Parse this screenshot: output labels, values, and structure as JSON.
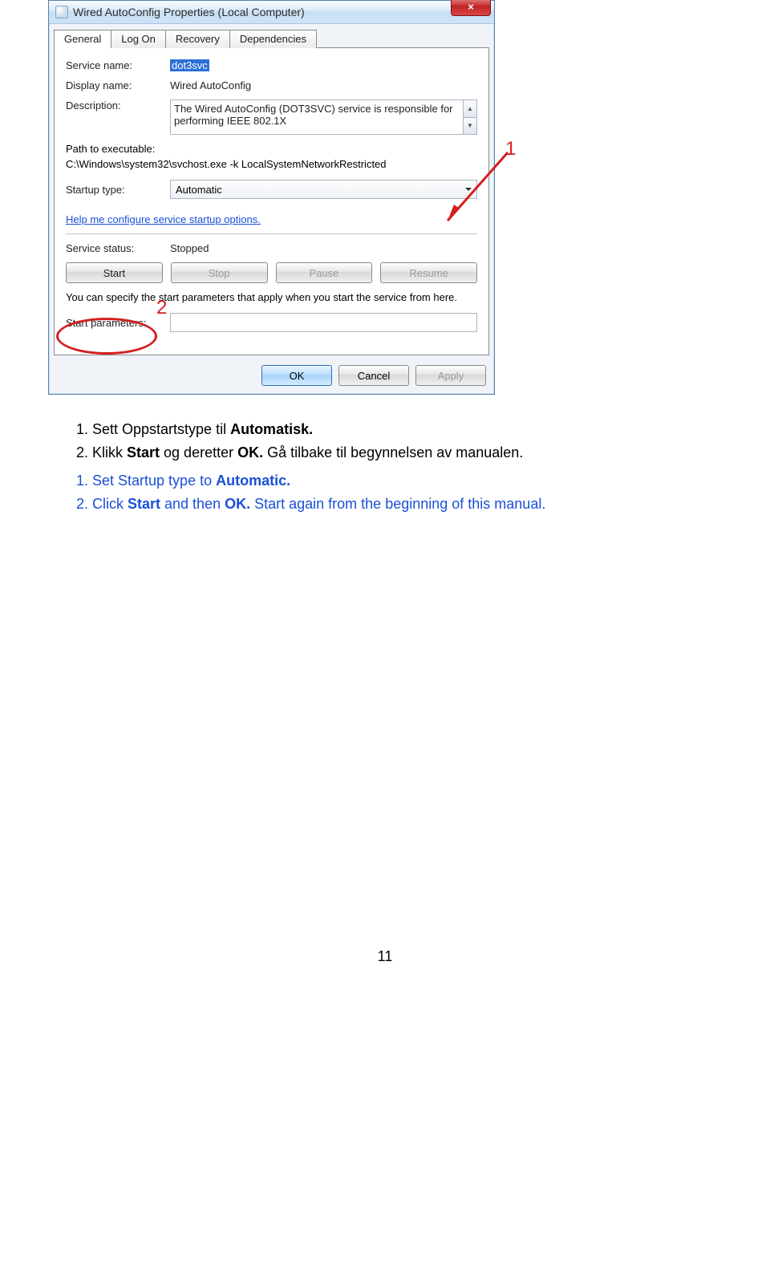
{
  "dialog": {
    "title": "Wired AutoConfig Properties (Local Computer)",
    "close_glyph": "×",
    "tabs": {
      "general": "General",
      "logon": "Log On",
      "recovery": "Recovery",
      "dependencies": "Dependencies"
    },
    "labels": {
      "service_name": "Service name:",
      "display_name": "Display name:",
      "description": "Description:",
      "path_label": "Path to executable:",
      "startup_type": "Startup type:",
      "service_status": "Service status:",
      "params_hint": "You can specify the start parameters that apply when you start the service from here.",
      "start_parameters": "Start parameters:"
    },
    "values": {
      "service_name": "dot3svc",
      "display_name": "Wired AutoConfig",
      "description": "The Wired AutoConfig (DOT3SVC) service is responsible for performing IEEE 802.1X",
      "path": "C:\\Windows\\system32\\svchost.exe -k LocalSystemNetworkRestricted",
      "startup_type": "Automatic",
      "help_link": "Help me configure service startup options.",
      "service_status": "Stopped"
    },
    "buttons": {
      "start": "Start",
      "stop": "Stop",
      "pause": "Pause",
      "resume": "Resume",
      "ok": "OK",
      "cancel": "Cancel",
      "apply": "Apply"
    }
  },
  "annotations": {
    "one": "1",
    "two": "2"
  },
  "instructions": {
    "no": {
      "i1_pre": "Sett Oppstartstype til ",
      "i1_bold": "Automatisk.",
      "i2_pre": "Klikk ",
      "i2_b1": "Start",
      "i2_mid": " og deretter ",
      "i2_b2": "OK.",
      "i2_post": " Gå tilbake til begynnelsen av manualen."
    },
    "en": {
      "i1_pre": "Set Startup type to ",
      "i1_bold": "Automatic.",
      "i2_pre": "Click ",
      "i2_b1": "Start",
      "i2_mid": " and then ",
      "i2_b2": "OK.",
      "i2_post": " Start again from the beginning of this manual."
    }
  },
  "page_number": "11"
}
